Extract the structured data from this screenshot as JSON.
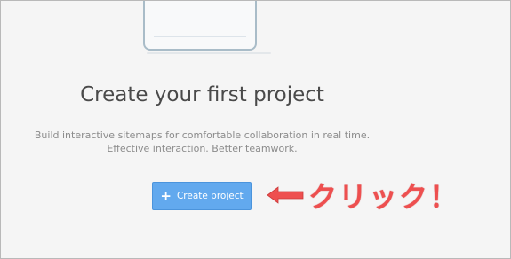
{
  "empty_state": {
    "title": "Create your first project",
    "subtitle_line1": "Build interactive sitemaps for comfortable collaboration in real time.",
    "subtitle_line2": "Effective interaction. Better teamwork."
  },
  "create_button": {
    "icon": "plus-icon",
    "icon_glyph": "+",
    "label": "Create project",
    "color": "#62a9ee"
  },
  "annotation": {
    "icon": "left-arrow-icon",
    "text": "クリック！",
    "color": "#ee4f4f"
  }
}
